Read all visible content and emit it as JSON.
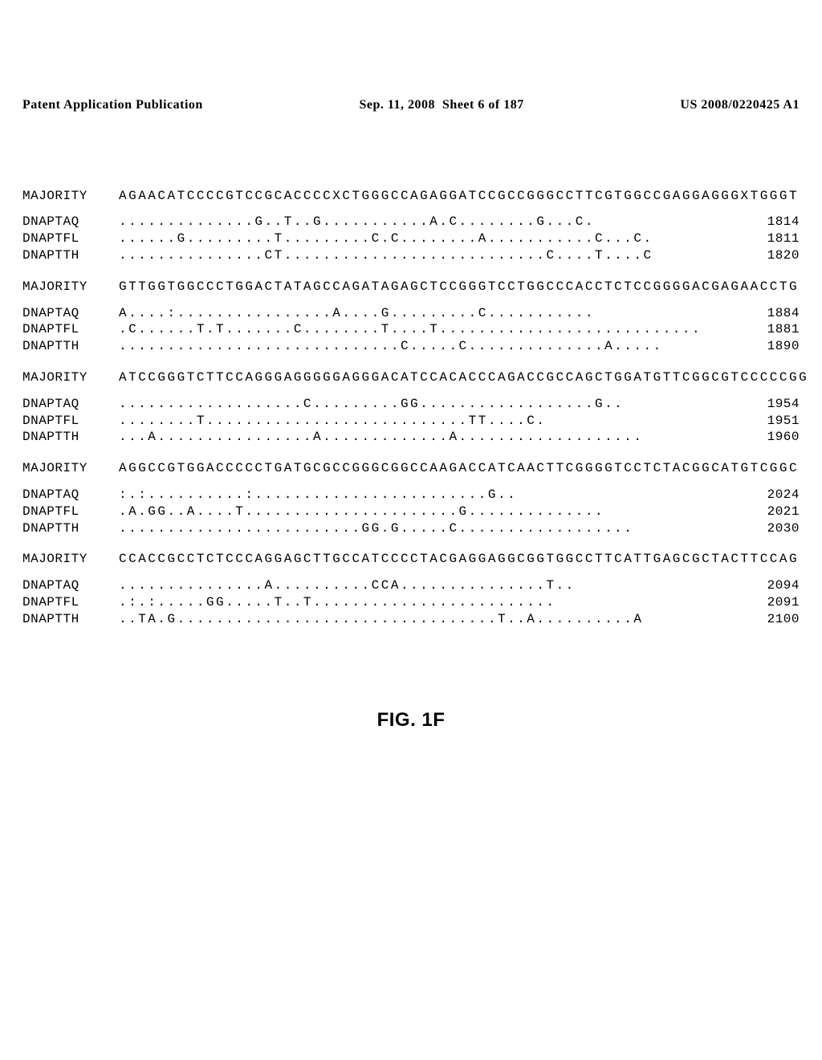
{
  "header": {
    "left": "Patent Application Publication",
    "center": "Sep. 11, 2008  Sheet 6 of 187",
    "right": "US 2008/0220425 A1"
  },
  "blocks": [
    {
      "majority": "AGAACATCCCCGTCCGCACCCCXCTGGGCCAGAGGATCCGCCGGGCCTTCGTGGCCGAGGAGGGXTGGGT",
      "rows": [
        {
          "label": "DNAPTAQ",
          "seq": "..............G..T..G...........A.C........G...C.",
          "num": "1814"
        },
        {
          "label": "DNAPTFL",
          "seq": "......G.........T.........C.C........A...........C...C.",
          "num": "1811"
        },
        {
          "label": "DNAPTTH",
          "seq": "...............CT...........................C....T....C",
          "num": "1820"
        }
      ]
    },
    {
      "majority": "GTTGGTGGCCCTGGACTATAGCCAGATAGAGCTCCGGGTCCTGGCCCACCTCTCCGGGGACGAGAACCTG",
      "rows": [
        {
          "label": "DNAPTAQ",
          "seq": "A....:................A....G.........C...........",
          "num": "1884"
        },
        {
          "label": "DNAPTFL",
          "seq": ".C......T.T.......C........T....T...........................",
          "num": "1881"
        },
        {
          "label": "DNAPTTH",
          "seq": ".............................C.....C..............A.....",
          "num": "1890"
        }
      ]
    },
    {
      "majority": "ATCCGGGTCTTCCAGGGAGGGGGAGGGACATCCACACCCAGACCGCCAGCTGGATGTTCGGCGTCCCCCGG",
      "rows": [
        {
          "label": "DNAPTAQ",
          "seq": "...................C.........GG..................G..",
          "num": "1954"
        },
        {
          "label": "DNAPTFL",
          "seq": "........T...........................TT....C.",
          "num": "1951"
        },
        {
          "label": "DNAPTTH",
          "seq": "...A................A.............A...................",
          "num": "1960"
        }
      ]
    },
    {
      "majority": "AGGCCGTGGACCCCCTGATGCGCCGGGCGGCCAAGACCATCAACTTCGGGGTCCTCTACGGCATGTCGGC",
      "rows": [
        {
          "label": "DNAPTAQ",
          "seq": ":.:..........:........................G..",
          "num": "2024"
        },
        {
          "label": "DNAPTFL",
          "seq": ".A.GG..A....T......................G..............",
          "num": "2021"
        },
        {
          "label": "DNAPTTH",
          "seq": ".........................GG.G.....C..................",
          "num": "2030"
        }
      ]
    },
    {
      "majority": "CCACCGCCTCTCCCAGGAGCTTGCCATCCCCTACGAGGAGGCGGTGGCCTTCATTGAGCGCTACTTCCAG",
      "rows": [
        {
          "label": "DNAPTAQ",
          "seq": "...............A..........CCA...............T..",
          "num": "2094"
        },
        {
          "label": "DNAPTFL",
          "seq": ".:.:.....GG.....T..T.........................",
          "num": "2091"
        },
        {
          "label": "DNAPTTH",
          "seq": "..TA.G.................................T..A..........A",
          "num": "2100"
        }
      ]
    }
  ],
  "figure_label": "FIG. 1F"
}
